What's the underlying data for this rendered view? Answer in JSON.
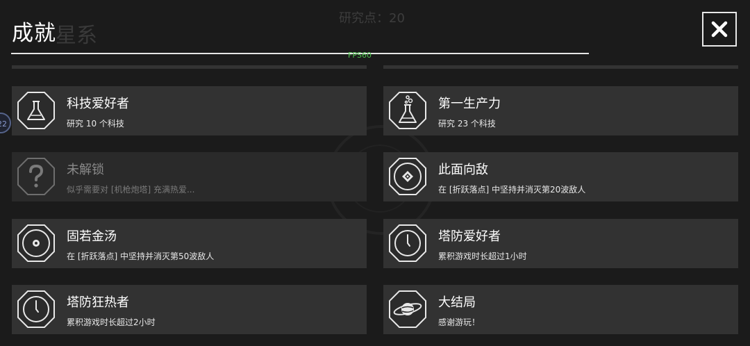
{
  "header": {
    "title": "成就",
    "close_glyph": "✕",
    "fps": "FPS60"
  },
  "background": {
    "title": "星系",
    "research_points": "研究点：20",
    "side_button": "22"
  },
  "achievements": [
    {
      "name": "科技爱好者",
      "desc": "研究 10 个科技",
      "icon": "flask-icon",
      "locked": false
    },
    {
      "name": "第一生产力",
      "desc": "研究 23 个科技",
      "icon": "bubbling-flask-icon",
      "locked": false
    },
    {
      "name": "未解锁",
      "desc": "似乎需要对 [机枪炮塔] 充满热爱...",
      "icon": "question-icon",
      "locked": true
    },
    {
      "name": "此面向敌",
      "desc": "在 [折跃落点] 中坚持并消灭第20波敌人",
      "icon": "target-diamond-icon",
      "locked": false
    },
    {
      "name": "固若金汤",
      "desc": "在 [折跃落点] 中坚持并消灭第50波敌人",
      "icon": "core-target-icon",
      "locked": false
    },
    {
      "name": "塔防爱好者",
      "desc": "累积游戏时长超过1小时",
      "icon": "clock-icon",
      "locked": false
    },
    {
      "name": "塔防狂热者",
      "desc": "累积游戏时长超过2小时",
      "icon": "clock-icon",
      "locked": false
    },
    {
      "name": "大结局",
      "desc": "感谢游玩！",
      "icon": "planet-icon",
      "locked": false
    }
  ]
}
